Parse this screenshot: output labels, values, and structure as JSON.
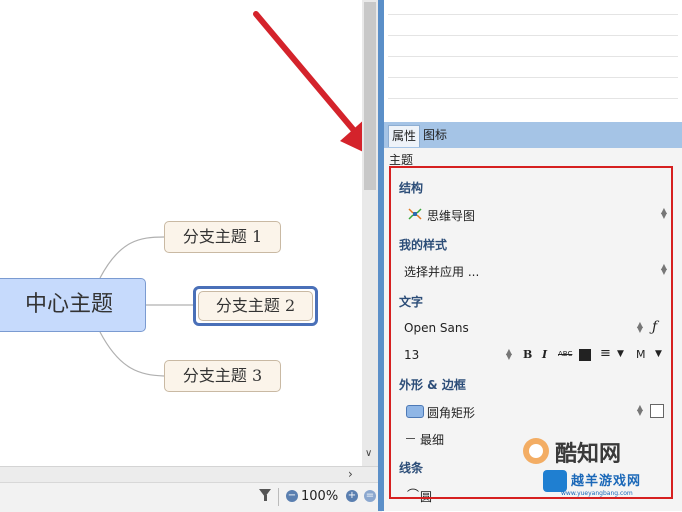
{
  "mindmap": {
    "center_topic": "中心主题",
    "branches": [
      "分支主题 1",
      "分支主题 2",
      "分支主题 3"
    ],
    "selected_index": 1
  },
  "statusbar": {
    "zoom": "100%",
    "filter_icon": "filter-icon",
    "zoom_out_icon": "zoom-out-icon",
    "zoom_in_icon": "zoom-in-icon"
  },
  "panel": {
    "tabs": [
      "属性",
      "图标"
    ],
    "active_tab": "属性",
    "subject": "主题",
    "sections": {
      "structure": {
        "title": "结构",
        "value": "思维导图"
      },
      "my_style": {
        "title": "我的样式",
        "value": "选择并应用 ..."
      },
      "text": {
        "title": "文字",
        "font": "Open Sans",
        "size": "13",
        "bold": "B",
        "italic": "I",
        "strike": "ABC",
        "align_m": "M"
      },
      "shape_border": {
        "title": "外形 & 边框",
        "shape": "圆角矩形",
        "border": "最细"
      },
      "lines": {
        "title": "线条",
        "line_value": "圆"
      }
    }
  },
  "watermark": {
    "brand": "酷知网",
    "site_name": "越羊游戏网",
    "url": "www.yueyangbang.com"
  },
  "colors": {
    "accent_blue": "#5b8fc8",
    "highlight_red": "#d62020",
    "center_fill": "#c6dafc",
    "branch_fill": "#fbf4ea",
    "arrow_red": "#d4232b"
  }
}
